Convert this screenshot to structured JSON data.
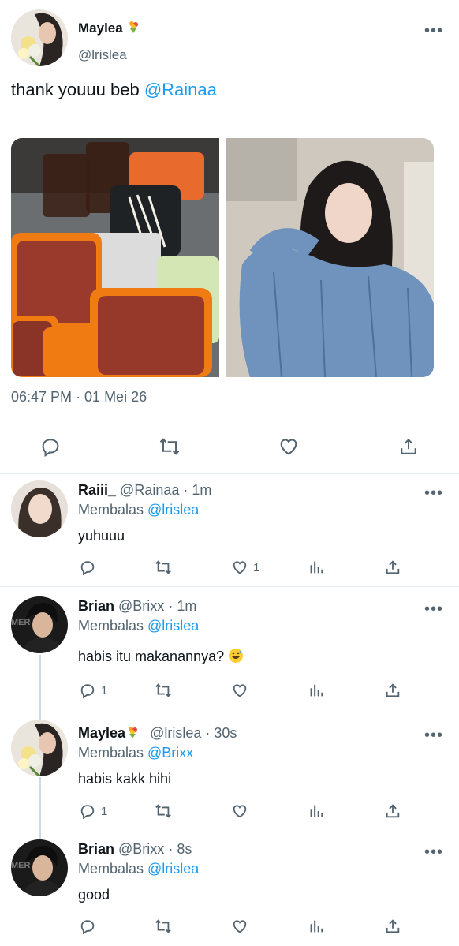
{
  "main_tweet": {
    "name": "Maylea",
    "handle": "@lrislea",
    "text_prefix": "thank youuu beb ",
    "mention": "@Rainaa",
    "timestamp": "06:47 PM · 01 Mei 26"
  },
  "replies": [
    {
      "name": "Raiii_",
      "handle": "@Rainaa",
      "time": "· 1m",
      "replying_prefix": "Membalas ",
      "replying_to": "@lrislea",
      "text": "yuhuuu",
      "reply_count": "",
      "like_count": "1"
    },
    {
      "name": "Brian",
      "handle": "@Brixx",
      "time": "· 1m",
      "replying_prefix": "Membalas ",
      "replying_to": "@lrislea",
      "text": "habis itu makanannya?",
      "reply_count": "1",
      "like_count": ""
    },
    {
      "name": "Maylea",
      "handle": "@lrislea",
      "time": "· 30s",
      "replying_prefix": "Membalas ",
      "replying_to": "@Brixx",
      "text": "habis kakk hihi",
      "reply_count": "1",
      "like_count": ""
    },
    {
      "name": "Brian",
      "handle": "@Brixx",
      "time": "· 8s",
      "replying_prefix": "Membalas ",
      "replying_to": "@lrislea",
      "text": "good",
      "reply_count": "",
      "like_count": ""
    }
  ],
  "icons": {
    "reply": "reply-icon",
    "retweet": "retweet-icon",
    "like": "heart-icon",
    "share": "share-icon",
    "analytics": "analytics-icon",
    "more": "more-icon"
  },
  "colors": {
    "link": "#1d9bf0",
    "secondary_text": "#536471",
    "divider": "#e6ecf0"
  }
}
